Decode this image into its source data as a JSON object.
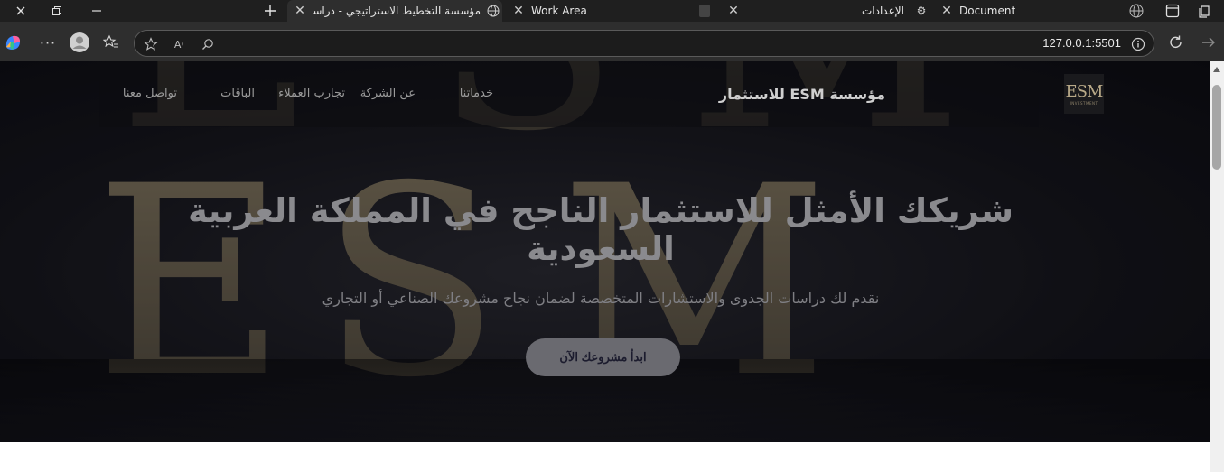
{
  "browser": {
    "tabs": [
      {
        "title": "مؤسسة التخطيط الاستراتيجي - دراسات",
        "active": true
      },
      {
        "title": "Work Area",
        "active": false
      },
      {
        "title": "الإعدادات",
        "active": false
      },
      {
        "title": "Document",
        "active": false
      }
    ],
    "url": "127.0.0.1:5501",
    "icons": {
      "new_tab": "plus-icon",
      "more": "ellipsis-icon",
      "favorites": "star-icon",
      "refresh": "refresh-icon",
      "forward": "arrow-right-icon"
    }
  },
  "site": {
    "brand": "مؤسسة ESM للاستثمار",
    "logo_text": "ESM",
    "logo_sub": "INVESTMENT",
    "nav": [
      "خدماتنا",
      "عن الشركة",
      "تجارب العملاء",
      "الباقات",
      "تواصل معنا"
    ],
    "hero": {
      "background_letters": "ESM",
      "title": "شريكك الأمثل للاستثمار الناجح في المملكة العربية السعودية",
      "subtitle": "نقدم لك دراسات الجدوى والاستشارات المتخصصة لضمان نجاح مشروعك الصناعي أو التجاري",
      "cta": "ابدأ مشروعك الآن"
    }
  },
  "colors": {
    "hero_bg": "#131318",
    "gold": "#b8a988",
    "cta_bg": "#6a6a70",
    "cta_text": "#1c1c2e"
  }
}
